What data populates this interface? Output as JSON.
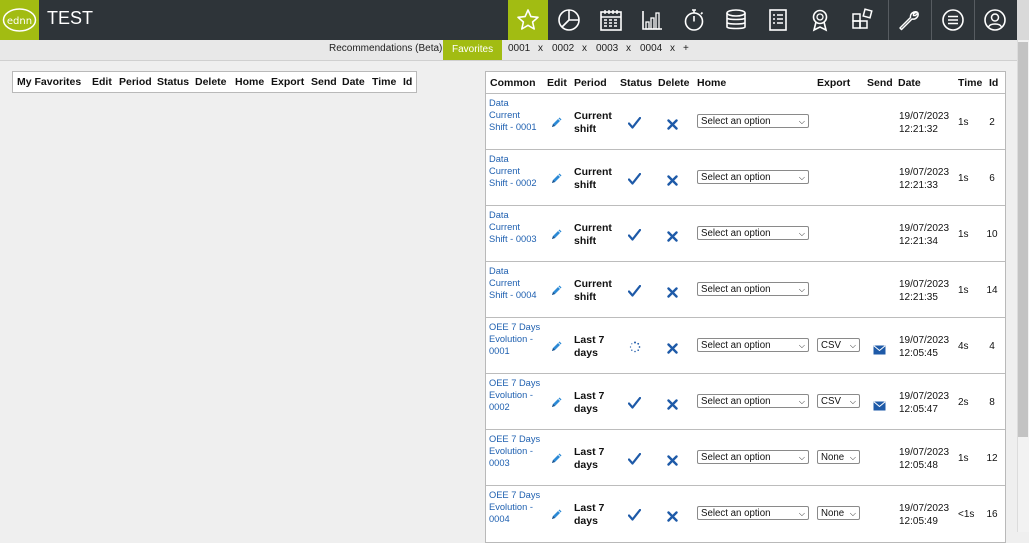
{
  "app": {
    "title": "TEST",
    "logo_icon": "ednn-logo"
  },
  "nav_icons": [
    {
      "name": "favorites-star-icon",
      "active": true
    },
    {
      "name": "pie-chart-icon"
    },
    {
      "name": "calendar-icon"
    },
    {
      "name": "bar-chart-icon"
    },
    {
      "name": "stopwatch-icon"
    },
    {
      "name": "database-icon"
    },
    {
      "name": "checklist-icon"
    },
    {
      "name": "award-icon"
    },
    {
      "name": "blocks-icon"
    },
    {
      "name": "wrench-icon"
    },
    {
      "name": "menu-icon"
    },
    {
      "name": "user-icon"
    }
  ],
  "colors": {
    "accent": "#a2bc12",
    "topbar": "#2e3439",
    "link": "#1f60b0",
    "icon_blue": "#1e5aa8"
  },
  "subtabs": {
    "recommendations": "Recommendations (Beta)",
    "favorites": "Favorites",
    "items": [
      {
        "label": "0001",
        "close": "x"
      },
      {
        "label": "0002",
        "close": "x"
      },
      {
        "label": "0003",
        "close": "x"
      },
      {
        "label": "0004",
        "close": "x"
      }
    ],
    "add": "+"
  },
  "favorites_table": {
    "headers": [
      "My Favorites",
      "Edit",
      "Period",
      "Status",
      "Delete",
      "Home",
      "Export",
      "Send",
      "Date",
      "Time",
      "Id"
    ]
  },
  "common_table": {
    "headers": [
      "Common",
      "Edit",
      "Period",
      "Status",
      "Delete",
      "Home",
      "Export",
      "Send",
      "Date",
      "Time",
      "Id"
    ],
    "home_placeholder": "Select an option",
    "rows": [
      {
        "name": "Data Current Shift - 0001",
        "period": "Current shift",
        "status": "done",
        "export": "",
        "send": false,
        "date": "19/07/2023",
        "time_of_day": "12:21:32",
        "duration": "1s",
        "id": "2"
      },
      {
        "name": "Data Current Shift - 0002",
        "period": "Current shift",
        "status": "done",
        "export": "",
        "send": false,
        "date": "19/07/2023",
        "time_of_day": "12:21:33",
        "duration": "1s",
        "id": "6"
      },
      {
        "name": "Data Current Shift - 0003",
        "period": "Current shift",
        "status": "done",
        "export": "",
        "send": false,
        "date": "19/07/2023",
        "time_of_day": "12:21:34",
        "duration": "1s",
        "id": "10"
      },
      {
        "name": "Data Current Shift - 0004",
        "period": "Current shift",
        "status": "done",
        "export": "",
        "send": false,
        "date": "19/07/2023",
        "time_of_day": "12:21:35",
        "duration": "1s",
        "id": "14"
      },
      {
        "name": "OEE 7 Days Evolution - 0001",
        "period": "Last 7 days",
        "status": "loading",
        "export": "CSV",
        "send": true,
        "date": "19/07/2023",
        "time_of_day": "12:05:45",
        "duration": "4s",
        "id": "4"
      },
      {
        "name": "OEE 7 Days Evolution - 0002",
        "period": "Last 7 days",
        "status": "done",
        "export": "CSV",
        "send": true,
        "date": "19/07/2023",
        "time_of_day": "12:05:47",
        "duration": "2s",
        "id": "8"
      },
      {
        "name": "OEE 7 Days Evolution - 0003",
        "period": "Last 7 days",
        "status": "done",
        "export": "None",
        "send": false,
        "date": "19/07/2023",
        "time_of_day": "12:05:48",
        "duration": "1s",
        "id": "12"
      },
      {
        "name": "OEE 7 Days Evolution - 0004",
        "period": "Last 7 days",
        "status": "done",
        "export": "None",
        "send": false,
        "date": "19/07/2023",
        "time_of_day": "12:05:49",
        "duration": "<1s",
        "id": "16"
      }
    ]
  }
}
